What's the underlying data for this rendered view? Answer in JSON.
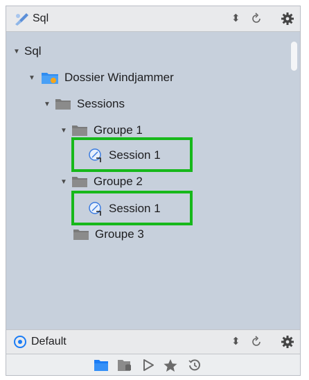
{
  "header": {
    "title": "Sql",
    "app_icon": "sql-pen-icon",
    "controls": [
      "stepper-icon",
      "refresh-icon",
      "gear-icon"
    ]
  },
  "tree": {
    "root": "Sql",
    "project": "Dossier Windjammer",
    "sessions_folder": "Sessions",
    "group1": "Groupe 1",
    "group1_session": "Session 1",
    "group2": "Groupe 2",
    "group2_session": "Session 1",
    "group3": "Groupe 3"
  },
  "footer": {
    "profile": "Default",
    "profile_icon": "target-icon",
    "controls": [
      "stepper-icon",
      "refresh-icon",
      "gear-icon"
    ]
  },
  "toolbar": {
    "icons": [
      "folder-icon",
      "database-icon",
      "play-icon",
      "star-icon",
      "history-icon"
    ],
    "active": "folder-icon"
  },
  "colors": {
    "highlight": "#17b81b",
    "accent": "#1a7cf5",
    "tree_bg": "#c7d0dc"
  }
}
